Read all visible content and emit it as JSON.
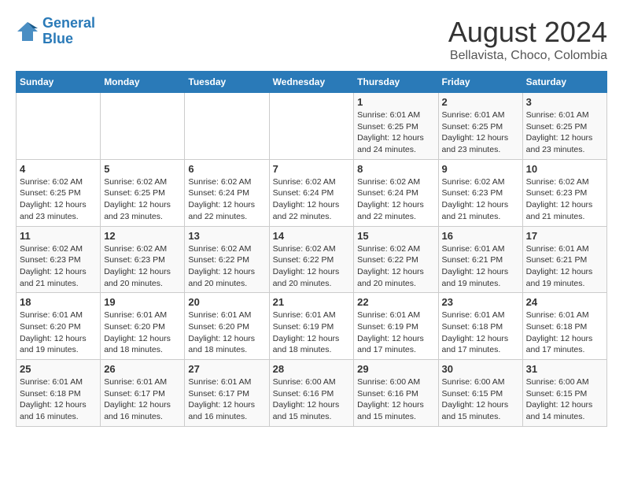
{
  "logo": {
    "line1": "General",
    "line2": "Blue"
  },
  "title": "August 2024",
  "subtitle": "Bellavista, Choco, Colombia",
  "days_header": [
    "Sunday",
    "Monday",
    "Tuesday",
    "Wednesday",
    "Thursday",
    "Friday",
    "Saturday"
  ],
  "weeks": [
    [
      {
        "day": "",
        "info": ""
      },
      {
        "day": "",
        "info": ""
      },
      {
        "day": "",
        "info": ""
      },
      {
        "day": "",
        "info": ""
      },
      {
        "day": "1",
        "info": "Sunrise: 6:01 AM\nSunset: 6:25 PM\nDaylight: 12 hours\nand 24 minutes."
      },
      {
        "day": "2",
        "info": "Sunrise: 6:01 AM\nSunset: 6:25 PM\nDaylight: 12 hours\nand 23 minutes."
      },
      {
        "day": "3",
        "info": "Sunrise: 6:01 AM\nSunset: 6:25 PM\nDaylight: 12 hours\nand 23 minutes."
      }
    ],
    [
      {
        "day": "4",
        "info": "Sunrise: 6:02 AM\nSunset: 6:25 PM\nDaylight: 12 hours\nand 23 minutes."
      },
      {
        "day": "5",
        "info": "Sunrise: 6:02 AM\nSunset: 6:25 PM\nDaylight: 12 hours\nand 23 minutes."
      },
      {
        "day": "6",
        "info": "Sunrise: 6:02 AM\nSunset: 6:24 PM\nDaylight: 12 hours\nand 22 minutes."
      },
      {
        "day": "7",
        "info": "Sunrise: 6:02 AM\nSunset: 6:24 PM\nDaylight: 12 hours\nand 22 minutes."
      },
      {
        "day": "8",
        "info": "Sunrise: 6:02 AM\nSunset: 6:24 PM\nDaylight: 12 hours\nand 22 minutes."
      },
      {
        "day": "9",
        "info": "Sunrise: 6:02 AM\nSunset: 6:23 PM\nDaylight: 12 hours\nand 21 minutes."
      },
      {
        "day": "10",
        "info": "Sunrise: 6:02 AM\nSunset: 6:23 PM\nDaylight: 12 hours\nand 21 minutes."
      }
    ],
    [
      {
        "day": "11",
        "info": "Sunrise: 6:02 AM\nSunset: 6:23 PM\nDaylight: 12 hours\nand 21 minutes."
      },
      {
        "day": "12",
        "info": "Sunrise: 6:02 AM\nSunset: 6:23 PM\nDaylight: 12 hours\nand 20 minutes."
      },
      {
        "day": "13",
        "info": "Sunrise: 6:02 AM\nSunset: 6:22 PM\nDaylight: 12 hours\nand 20 minutes."
      },
      {
        "day": "14",
        "info": "Sunrise: 6:02 AM\nSunset: 6:22 PM\nDaylight: 12 hours\nand 20 minutes."
      },
      {
        "day": "15",
        "info": "Sunrise: 6:02 AM\nSunset: 6:22 PM\nDaylight: 12 hours\nand 20 minutes."
      },
      {
        "day": "16",
        "info": "Sunrise: 6:01 AM\nSunset: 6:21 PM\nDaylight: 12 hours\nand 19 minutes."
      },
      {
        "day": "17",
        "info": "Sunrise: 6:01 AM\nSunset: 6:21 PM\nDaylight: 12 hours\nand 19 minutes."
      }
    ],
    [
      {
        "day": "18",
        "info": "Sunrise: 6:01 AM\nSunset: 6:20 PM\nDaylight: 12 hours\nand 19 minutes."
      },
      {
        "day": "19",
        "info": "Sunrise: 6:01 AM\nSunset: 6:20 PM\nDaylight: 12 hours\nand 18 minutes."
      },
      {
        "day": "20",
        "info": "Sunrise: 6:01 AM\nSunset: 6:20 PM\nDaylight: 12 hours\nand 18 minutes."
      },
      {
        "day": "21",
        "info": "Sunrise: 6:01 AM\nSunset: 6:19 PM\nDaylight: 12 hours\nand 18 minutes."
      },
      {
        "day": "22",
        "info": "Sunrise: 6:01 AM\nSunset: 6:19 PM\nDaylight: 12 hours\nand 17 minutes."
      },
      {
        "day": "23",
        "info": "Sunrise: 6:01 AM\nSunset: 6:18 PM\nDaylight: 12 hours\nand 17 minutes."
      },
      {
        "day": "24",
        "info": "Sunrise: 6:01 AM\nSunset: 6:18 PM\nDaylight: 12 hours\nand 17 minutes."
      }
    ],
    [
      {
        "day": "25",
        "info": "Sunrise: 6:01 AM\nSunset: 6:18 PM\nDaylight: 12 hours\nand 16 minutes."
      },
      {
        "day": "26",
        "info": "Sunrise: 6:01 AM\nSunset: 6:17 PM\nDaylight: 12 hours\nand 16 minutes."
      },
      {
        "day": "27",
        "info": "Sunrise: 6:01 AM\nSunset: 6:17 PM\nDaylight: 12 hours\nand 16 minutes."
      },
      {
        "day": "28",
        "info": "Sunrise: 6:00 AM\nSunset: 6:16 PM\nDaylight: 12 hours\nand 15 minutes."
      },
      {
        "day": "29",
        "info": "Sunrise: 6:00 AM\nSunset: 6:16 PM\nDaylight: 12 hours\nand 15 minutes."
      },
      {
        "day": "30",
        "info": "Sunrise: 6:00 AM\nSunset: 6:15 PM\nDaylight: 12 hours\nand 15 minutes."
      },
      {
        "day": "31",
        "info": "Sunrise: 6:00 AM\nSunset: 6:15 PM\nDaylight: 12 hours\nand 14 minutes."
      }
    ]
  ]
}
